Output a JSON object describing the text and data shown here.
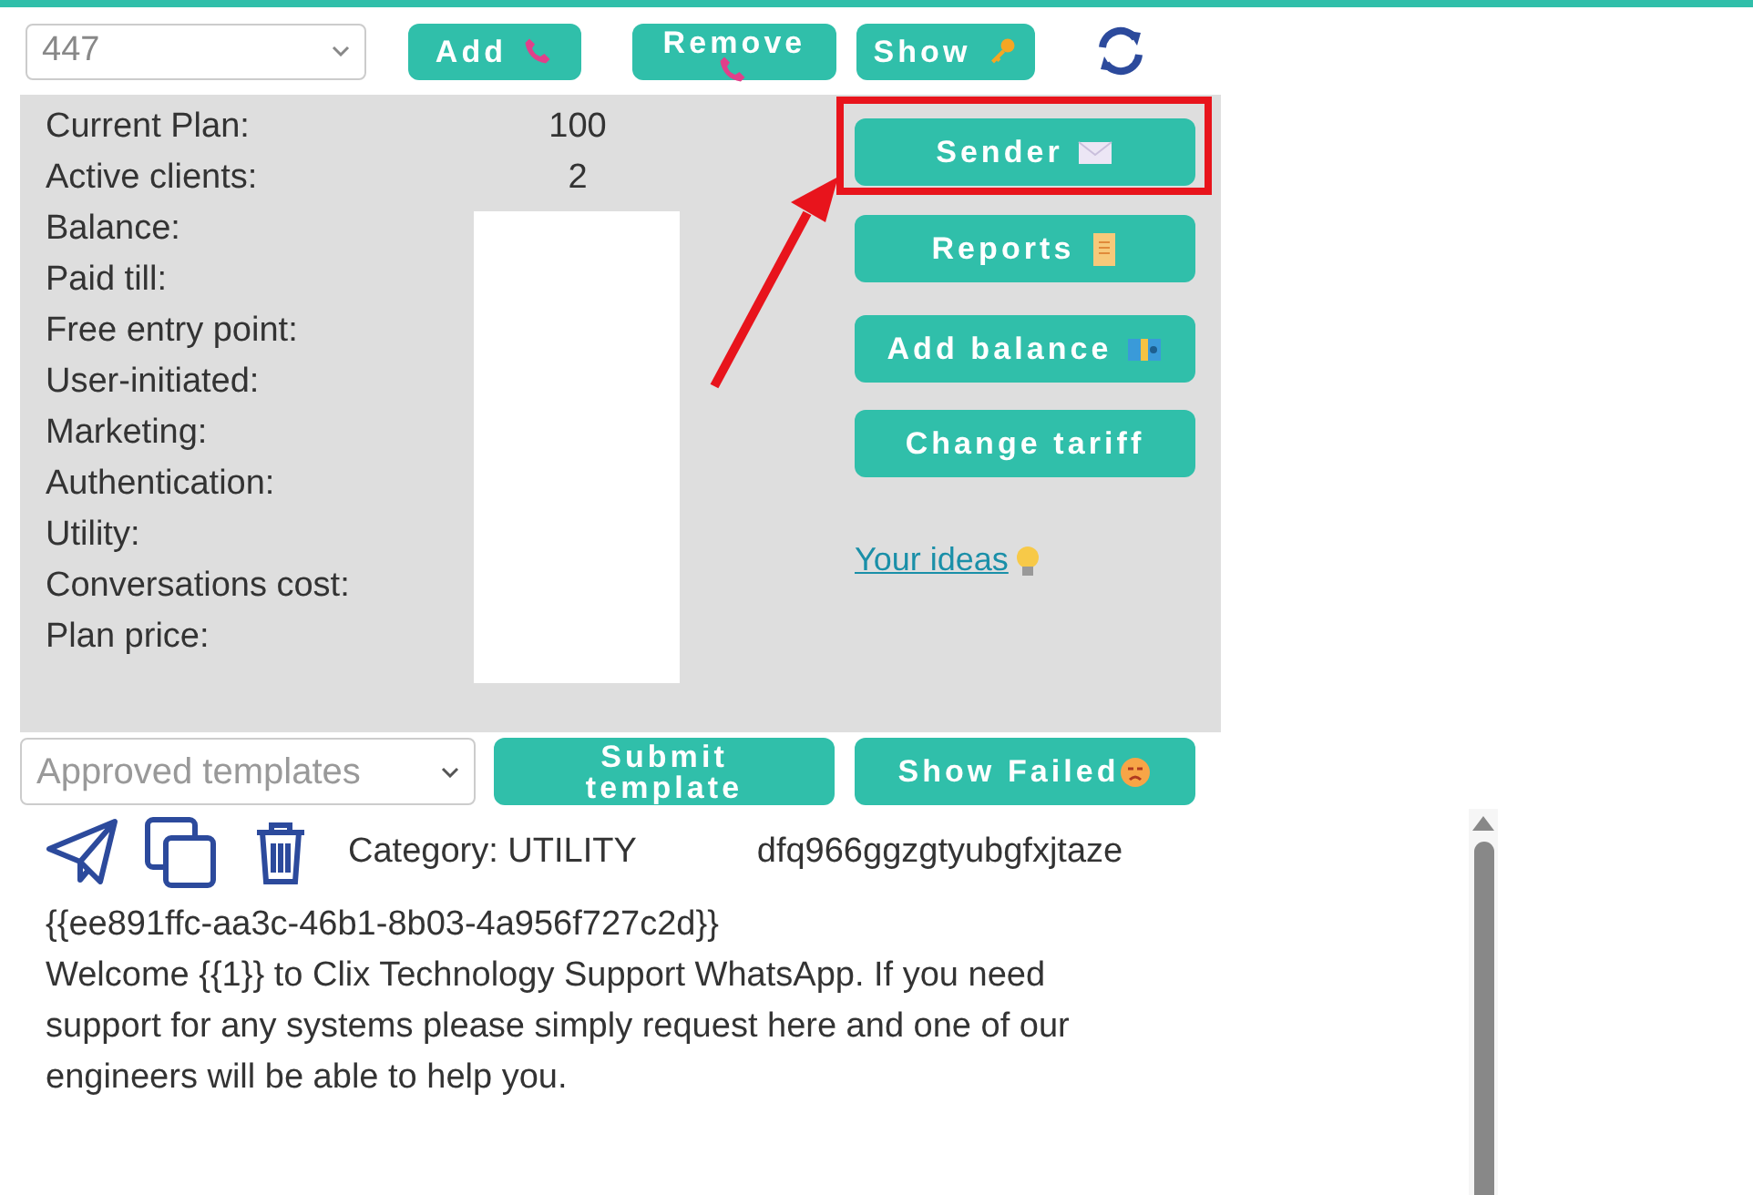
{
  "number_select": {
    "value": "447"
  },
  "add_button": {
    "label": "Add"
  },
  "remove_button": {
    "label": "Remove"
  },
  "show_button": {
    "label": "Show"
  },
  "stats": [
    {
      "label": "Current Plan:",
      "value": "100"
    },
    {
      "label": "Active clients:",
      "value": "2"
    },
    {
      "label": "Balance:"
    },
    {
      "label": "Paid till:"
    },
    {
      "label": "Free entry point:"
    },
    {
      "label": "User-initiated:"
    },
    {
      "label": "Marketing:"
    },
    {
      "label": "Authentication:"
    },
    {
      "label": "Utility:"
    },
    {
      "label": "Conversations cost:"
    },
    {
      "label": "Plan price:"
    }
  ],
  "sender_button": {
    "label": "Sender",
    "highlighted": true
  },
  "reports_button": {
    "label": "Reports"
  },
  "add_balance_button": {
    "label": "Add balance"
  },
  "change_tariff_button": {
    "label": "Change tariff"
  },
  "ideas_link": {
    "label": "Your ideas"
  },
  "templates_select": {
    "placeholder": "Approved templates"
  },
  "submit_template_button": {
    "label": "Submit template"
  },
  "show_failed_button": {
    "label": "Show Failed"
  },
  "template": {
    "category": "Category: UTILITY",
    "name": "dfq966ggzgtyubgfxjtaze",
    "id": "{{ee891ffc-aa3c-46b1-8b03-4a956f727c2d}}",
    "body": "Welcome {{1}} to Clix Technology Support WhatsApp. If you need support for any systems please simply request here and one of our engineers will be able to help you."
  }
}
